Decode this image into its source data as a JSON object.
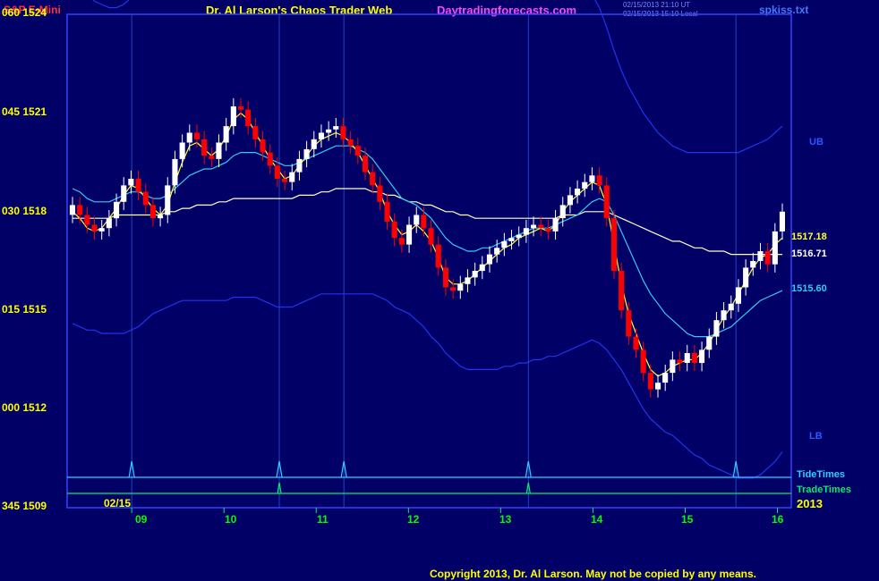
{
  "header": {
    "symbol": "S&P E-Mini",
    "title": "Dr. Al Larson's Chaos Trader Web",
    "site": "Daytradingforecasts.com",
    "stamp1": "02/15/2013 21:10 UT",
    "stamp2": "02/15/2013 15:10 Local",
    "file": "spkiss.txt"
  },
  "colors": {
    "background": "#000066",
    "frame": "#3344ff",
    "up_bar": "#ffffff",
    "down_bar": "#ff0000",
    "band": "#2233ee",
    "ema_short": "#ffff33",
    "ema_mid": "#33ccee",
    "ema_long": "#ffffcc",
    "tide": "#33ccff",
    "trade": "#00ee66"
  },
  "chart_data": {
    "type": "candlestick",
    "y_axis": {
      "labels": [
        "060  1524",
        "045  1521",
        "030  1518",
        "015  1515",
        "000  1512",
        "345  1509"
      ],
      "ylim": [
        1509,
        1524
      ]
    },
    "x_axis": {
      "labels": [
        "09",
        "10",
        "11",
        "12",
        "13",
        "14",
        "15",
        "16"
      ],
      "xlim": [
        8.3,
        16.15
      ],
      "date_label": "02/15",
      "year_label": "2013"
    },
    "series_labels": {
      "ub": "UB",
      "lb": "LB",
      "ema_short_value": "1517.18",
      "ema_long_value": "1516.71",
      "ema_mid_value": "1515.60",
      "tide": "TideTimes",
      "trade": "TradeTimes"
    },
    "closes": [
      1518.2,
      1517.9,
      1517.6,
      1517.4,
      1517.5,
      1517.8,
      1518.3,
      1518.8,
      1519.0,
      1518.6,
      1518.2,
      1517.8,
      1517.9,
      1518.8,
      1519.6,
      1520.1,
      1520.4,
      1520.2,
      1519.7,
      1519.6,
      1520.1,
      1520.6,
      1521.2,
      1521.1,
      1520.6,
      1520.2,
      1519.8,
      1519.4,
      1519.0,
      1518.9,
      1519.2,
      1519.6,
      1519.9,
      1520.2,
      1520.4,
      1520.5,
      1520.6,
      1520.2,
      1520.0,
      1519.7,
      1519.2,
      1518.8,
      1518.3,
      1517.7,
      1517.2,
      1517.0,
      1517.6,
      1517.9,
      1517.5,
      1517.0,
      1516.3,
      1515.7,
      1515.6,
      1515.8,
      1516.0,
      1516.2,
      1516.4,
      1516.7,
      1516.9,
      1517.1,
      1517.2,
      1517.3,
      1517.5,
      1517.6,
      1517.5,
      1517.4,
      1517.8,
      1518.2,
      1518.5,
      1518.7,
      1518.9,
      1519.1,
      1518.8,
      1517.8,
      1516.2,
      1515.0,
      1514.2,
      1513.8,
      1513.1,
      1512.6,
      1512.8,
      1513.1,
      1513.5,
      1513.4,
      1513.7,
      1513.4,
      1513.8,
      1514.2,
      1514.7,
      1515.0,
      1515.2,
      1515.7,
      1516.3,
      1516.5,
      1516.8,
      1516.4,
      1517.4,
      1518.0
    ],
    "ema_short": [
      1518.0,
      1517.8,
      1517.5,
      1517.4,
      1517.5,
      1517.8,
      1518.1,
      1518.5,
      1518.8,
      1518.7,
      1518.4,
      1518.1,
      1517.9,
      1518.2,
      1518.9,
      1519.5,
      1520.0,
      1520.1,
      1519.9,
      1519.7,
      1519.9,
      1520.3,
      1520.8,
      1521.0,
      1520.8,
      1520.4,
      1520.0,
      1519.6,
      1519.3,
      1519.0,
      1519.1,
      1519.4,
      1519.7,
      1520.0,
      1520.2,
      1520.3,
      1520.4,
      1520.3,
      1520.1,
      1519.8,
      1519.4,
      1519.0,
      1518.6,
      1518.0,
      1517.6,
      1517.3,
      1517.4,
      1517.6,
      1517.4,
      1517.1,
      1516.6,
      1516.0,
      1515.8,
      1515.8,
      1515.9,
      1516.1,
      1516.3,
      1516.5,
      1516.7,
      1516.9,
      1517.0,
      1517.2,
      1517.3,
      1517.4,
      1517.5,
      1517.4,
      1517.6,
      1518.0,
      1518.3,
      1518.5,
      1518.7,
      1518.9,
      1518.8,
      1518.2,
      1517.0,
      1515.8,
      1514.9,
      1514.3,
      1513.7,
      1513.2,
      1513.0,
      1513.1,
      1513.3,
      1513.4,
      1513.5,
      1513.5,
      1513.7,
      1514.0,
      1514.4,
      1514.8,
      1515.1,
      1515.5,
      1515.9,
      1516.3,
      1516.6,
      1516.7,
      1517.0,
      1517.2
    ],
    "ema_mid": [
      1518.7,
      1518.6,
      1518.4,
      1518.3,
      1518.3,
      1518.3,
      1518.4,
      1518.5,
      1518.6,
      1518.6,
      1518.5,
      1518.4,
      1518.4,
      1518.5,
      1518.7,
      1518.9,
      1519.1,
      1519.2,
      1519.3,
      1519.3,
      1519.4,
      1519.5,
      1519.7,
      1519.8,
      1519.8,
      1519.8,
      1519.7,
      1519.6,
      1519.5,
      1519.4,
      1519.4,
      1519.5,
      1519.6,
      1519.7,
      1519.8,
      1519.9,
      1520.0,
      1520.0,
      1520.0,
      1519.9,
      1519.8,
      1519.6,
      1519.3,
      1519.0,
      1518.7,
      1518.4,
      1518.3,
      1518.2,
      1518.0,
      1517.8,
      1517.5,
      1517.2,
      1517.0,
      1516.9,
      1516.8,
      1516.8,
      1516.9,
      1516.9,
      1517.0,
      1517.1,
      1517.2,
      1517.3,
      1517.4,
      1517.5,
      1517.5,
      1517.5,
      1517.6,
      1517.7,
      1517.8,
      1517.9,
      1518.1,
      1518.3,
      1518.4,
      1518.3,
      1517.9,
      1517.4,
      1516.9,
      1516.4,
      1515.9,
      1515.5,
      1515.2,
      1514.9,
      1514.7,
      1514.5,
      1514.3,
      1514.2,
      1514.2,
      1514.2,
      1514.3,
      1514.4,
      1514.5,
      1514.7,
      1514.9,
      1515.1,
      1515.3,
      1515.4,
      1515.5,
      1515.6
    ],
    "ema_long": [
      1517.8,
      1517.8,
      1517.8,
      1517.8,
      1517.8,
      1517.8,
      1517.9,
      1517.9,
      1517.9,
      1517.9,
      1517.9,
      1517.9,
      1517.9,
      1518.0,
      1518.0,
      1518.1,
      1518.1,
      1518.2,
      1518.2,
      1518.2,
      1518.3,
      1518.3,
      1518.4,
      1518.4,
      1518.4,
      1518.4,
      1518.4,
      1518.4,
      1518.4,
      1518.4,
      1518.4,
      1518.5,
      1518.5,
      1518.5,
      1518.6,
      1518.6,
      1518.7,
      1518.7,
      1518.7,
      1518.7,
      1518.7,
      1518.6,
      1518.6,
      1518.5,
      1518.5,
      1518.4,
      1518.3,
      1518.3,
      1518.2,
      1518.2,
      1518.1,
      1518.0,
      1518.0,
      1517.9,
      1517.9,
      1517.8,
      1517.8,
      1517.8,
      1517.8,
      1517.8,
      1517.8,
      1517.8,
      1517.8,
      1517.8,
      1517.8,
      1517.8,
      1517.8,
      1517.9,
      1517.9,
      1517.9,
      1518.0,
      1518.0,
      1518.0,
      1518.0,
      1517.9,
      1517.8,
      1517.7,
      1517.6,
      1517.5,
      1517.4,
      1517.3,
      1517.2,
      1517.1,
      1517.1,
      1517.0,
      1516.9,
      1516.9,
      1516.8,
      1516.8,
      1516.8,
      1516.7,
      1516.7,
      1516.7,
      1516.7,
      1516.7,
      1516.7,
      1516.7,
      1516.7
    ],
    "upper_band": [
      1525.0,
      1524.8,
      1524.6,
      1524.4,
      1524.3,
      1524.2,
      1524.2,
      1524.3,
      1524.5,
      1524.7,
      1524.9,
      1525.0,
      1525.1,
      1525.1,
      1525.0,
      1524.8,
      1524.6,
      1524.5,
      1524.5,
      1524.6,
      1524.7,
      1524.8,
      1524.9,
      1524.9,
      1524.8,
      1524.7,
      1524.6,
      1524.6,
      1524.7,
      1524.8,
      1524.9,
      1525.0,
      1525.0,
      1525.0,
      1524.9,
      1524.8,
      1524.7,
      1524.6,
      1524.6,
      1524.7,
      1524.8,
      1524.9,
      1525.0,
      1525.1,
      1525.2,
      1525.2,
      1525.1,
      1525.0,
      1524.9,
      1524.9,
      1525.0,
      1525.0,
      1525.1,
      1525.1,
      1525.2,
      1525.2,
      1525.1,
      1525.0,
      1524.9,
      1524.8,
      1524.7,
      1524.6,
      1524.6,
      1524.6,
      1524.6,
      1524.7,
      1524.8,
      1524.9,
      1524.9,
      1524.9,
      1524.8,
      1524.6,
      1524.2,
      1523.6,
      1522.9,
      1522.3,
      1521.8,
      1521.4,
      1521.0,
      1520.7,
      1520.4,
      1520.2,
      1520.0,
      1519.9,
      1519.8,
      1519.8,
      1519.8,
      1519.8,
      1519.8,
      1519.8,
      1519.8,
      1519.8,
      1519.9,
      1520.0,
      1520.1,
      1520.2,
      1520.4,
      1520.6
    ],
    "lower_band": [
      1514.6,
      1514.5,
      1514.4,
      1514.4,
      1514.3,
      1514.3,
      1514.3,
      1514.3,
      1514.4,
      1514.5,
      1514.7,
      1514.9,
      1515.0,
      1515.1,
      1515.2,
      1515.3,
      1515.3,
      1515.3,
      1515.3,
      1515.3,
      1515.3,
      1515.3,
      1515.4,
      1515.4,
      1515.4,
      1515.4,
      1515.3,
      1515.2,
      1515.1,
      1515.1,
      1515.1,
      1515.2,
      1515.3,
      1515.4,
      1515.5,
      1515.5,
      1515.5,
      1515.5,
      1515.5,
      1515.5,
      1515.5,
      1515.5,
      1515.4,
      1515.3,
      1515.1,
      1515.0,
      1514.9,
      1514.7,
      1514.5,
      1514.2,
      1514.0,
      1513.7,
      1513.5,
      1513.3,
      1513.2,
      1513.2,
      1513.2,
      1513.2,
      1513.2,
      1513.3,
      1513.3,
      1513.4,
      1513.4,
      1513.5,
      1513.5,
      1513.6,
      1513.6,
      1513.7,
      1513.8,
      1513.9,
      1514.0,
      1514.1,
      1514.0,
      1513.8,
      1513.5,
      1513.2,
      1512.8,
      1512.4,
      1512.0,
      1511.7,
      1511.5,
      1511.3,
      1511.2,
      1511.0,
      1510.8,
      1510.6,
      1510.5,
      1510.3,
      1510.2,
      1510.1,
      1510.0,
      1509.9,
      1509.9,
      1509.9,
      1510.0,
      1510.2,
      1510.4,
      1510.7
    ],
    "tide_times": [
      9.0,
      10.6,
      11.3,
      13.3,
      15.55
    ],
    "trade_times": [
      10.6,
      13.3
    ]
  },
  "footer": {
    "copyright": "Copyright 2013, Dr. Al Larson. May not be copied by any means."
  }
}
